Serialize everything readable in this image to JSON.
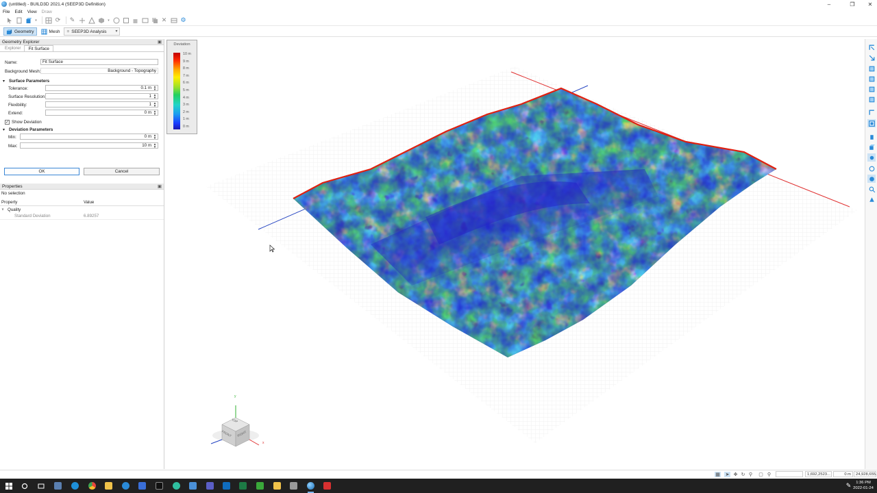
{
  "window": {
    "title": "(untitled) - BUILD3D 2021.4 (SEEP3D Definition)"
  },
  "menu": [
    "File",
    "Edit",
    "View",
    "Draw"
  ],
  "modebar": {
    "geometry": "Geometry",
    "mesh": "Mesh",
    "analysis": "SEEP3D Analysis"
  },
  "explorer": {
    "header": "Geometry Explorer",
    "tabs": [
      "Explorer",
      "Fit Surface"
    ],
    "name_label": "Name:",
    "name_value": "Fit Surface",
    "bgmesh_label": "Background Mesh:",
    "bgmesh_value": "Background - Topography",
    "surface_params": "Surface Parameters",
    "tolerance_label": "Tolerance:",
    "tolerance_value": "0.1 m",
    "resolution_label": "Surface Resolution:",
    "resolution_value": "1",
    "flexibility_label": "Flexibility:",
    "flexibility_value": "1",
    "extend_label": "Extend:",
    "extend_value": "0 m",
    "show_deviation": "Show Deviation",
    "deviation_params": "Deviation Parameters",
    "min_label": "Min:",
    "min_value": "0 m",
    "max_label": "Max:",
    "max_value": "10 m",
    "ok": "OK",
    "cancel": "Cancel"
  },
  "properties": {
    "header": "Properties",
    "selection": "No selection",
    "col_property": "Property",
    "col_value": "Value",
    "group": "Quality",
    "row_label": "Standard Deviation",
    "row_value": "6.89257"
  },
  "legend": {
    "title": "Deviation",
    "ticks": [
      "10 m",
      "9 m",
      "8 m",
      "7 m",
      "6 m",
      "5 m",
      "4 m",
      "3 m",
      "2 m",
      "1 m",
      "0 m"
    ]
  },
  "viewcube": {
    "top": "TOP",
    "front": "FRONT",
    "right": "RIGHT",
    "x": "x",
    "y": "y"
  },
  "status": {
    "coord1": "1,692,2523...",
    "coord2": "0 m",
    "coord3": "24,928,655..."
  },
  "clock": {
    "time": "1:36 PM",
    "date": "2022-01-24"
  },
  "colors": {
    "accent": "#2a8ad8",
    "axis_red": "#e03030",
    "axis_blue": "#2040c0"
  }
}
